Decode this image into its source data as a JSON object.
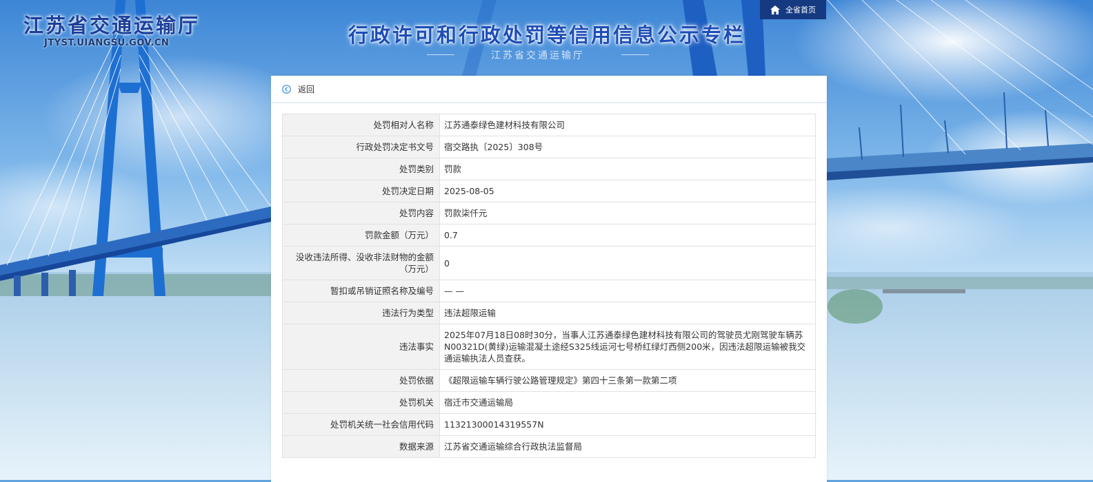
{
  "header": {
    "logo_cn": "江苏省交通运输厅",
    "logo_en": "JTYST.UIANGSU.GOV.CN",
    "banner_title": "行政许可和行政处罚等信用信息公示专栏",
    "banner_subtitle": "江苏省交通运输厅",
    "home_button": "全省首页",
    "home_icon": "home-icon"
  },
  "nav": {
    "back_label": "返回",
    "back_icon": "circle-back-arrow-icon"
  },
  "colors": {
    "accent": "#1d4db5",
    "home_bg": "#153a82",
    "label_bg": "#f2f2f2"
  },
  "record": {
    "rows": [
      {
        "label": "处罚相对人名称",
        "value": "江苏通泰绿色建材科技有限公司"
      },
      {
        "label": "行政处罚决定书文号",
        "value": "宿交路执〔2025〕308号"
      },
      {
        "label": "处罚类别",
        "value": "罚款"
      },
      {
        "label": "处罚决定日期",
        "value": "2025-08-05"
      },
      {
        "label": "处罚内容",
        "value": "罚款柒仟元"
      },
      {
        "label": "罚款金额（万元）",
        "value": "0.7"
      },
      {
        "label": "没收违法所得、没收非法财物的金额（万元）",
        "value": "0"
      },
      {
        "label": "暂扣或吊销证照名称及编号",
        "value": "— —"
      },
      {
        "label": "违法行为类型",
        "value": "违法超限运输"
      },
      {
        "label": "违法事实",
        "value": "2025年07月18日08时30分，当事人江苏通泰绿色建材科技有限公司的驾驶员尤刚驾驶车辆苏N00321D(黄绿)运输混凝土途经S325线运河七号桥红绿灯西侧200米，因违法超限运输被我交通运输执法人员查获。"
      },
      {
        "label": "处罚依据",
        "value": "《超限运输车辆行驶公路管理规定》第四十三条第一款第二项"
      },
      {
        "label": "处罚机关",
        "value": "宿迁市交通运输局"
      },
      {
        "label": "处罚机关统一社会信用代码",
        "value": "11321300014319557N"
      },
      {
        "label": "数据来源",
        "value": "江苏省交通运输综合行政执法监督局"
      }
    ]
  }
}
